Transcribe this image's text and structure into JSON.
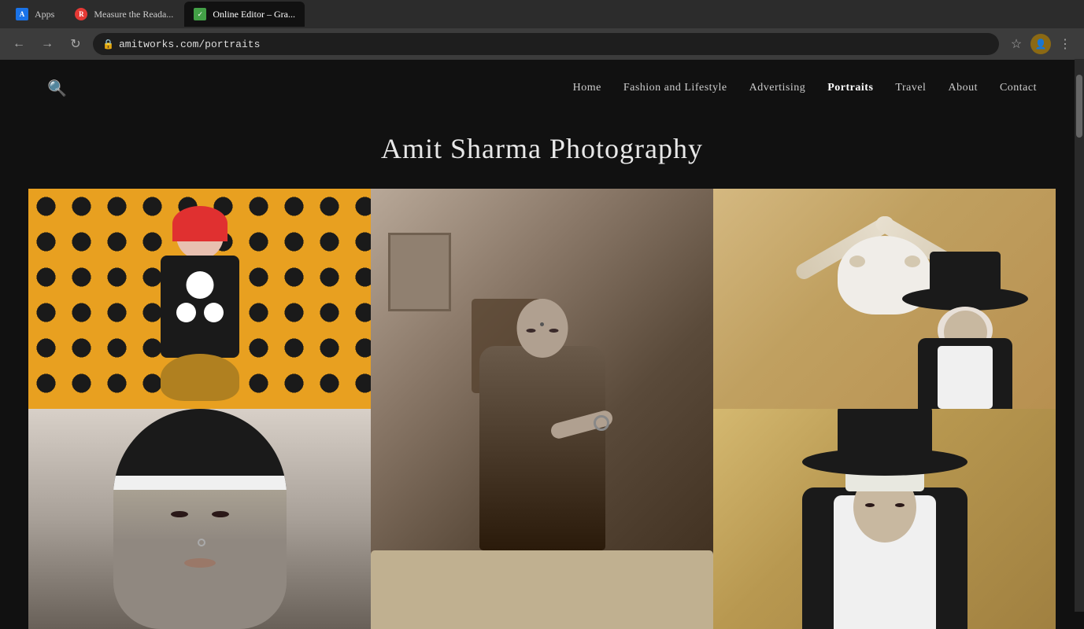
{
  "browser": {
    "url": "amitworks.com/portraits",
    "protocol_icon": "🔒",
    "back_btn": "←",
    "forward_btn": "→",
    "refresh_btn": "↻"
  },
  "tabs": [
    {
      "id": "apps",
      "label": "Apps",
      "favicon_type": "apps",
      "active": false
    },
    {
      "id": "measure",
      "label": "Measure the Reada...",
      "favicon_type": "red",
      "active": false
    },
    {
      "id": "editor",
      "label": "Online Editor – Gra...",
      "favicon_type": "green",
      "active": true
    }
  ],
  "site": {
    "nav": {
      "search_icon": "🔍",
      "links": [
        {
          "id": "home",
          "label": "Home",
          "active": false
        },
        {
          "id": "fashion",
          "label": "Fashion and Lifestyle",
          "active": false
        },
        {
          "id": "advertising",
          "label": "Advertising",
          "active": false
        },
        {
          "id": "portraits",
          "label": "Portraits",
          "active": true
        },
        {
          "id": "travel",
          "label": "Travel",
          "active": false
        },
        {
          "id": "about",
          "label": "About",
          "active": false
        },
        {
          "id": "contact",
          "label": "Contact",
          "active": false
        }
      ]
    },
    "title": "Amit Sharma Photography",
    "gallery": {
      "items": [
        {
          "id": "img1",
          "row": 0,
          "col": 0,
          "alt": "Woman in yellow polka dot setting with red wig"
        },
        {
          "id": "img2",
          "row": 0,
          "col": 1,
          "alt": "Black and white portrait of woman in saree"
        },
        {
          "id": "img3",
          "row": 0,
          "col": 2,
          "alt": "Bull skull on tan wall with woman in black hat"
        },
        {
          "id": "img4",
          "row": 1,
          "col": 0,
          "alt": "Black and white close-up face with head covering"
        },
        {
          "id": "img5",
          "row": 1,
          "col": 1,
          "alt": "Seated woman in saree black and white"
        },
        {
          "id": "img6",
          "row": 1,
          "col": 2,
          "alt": "Woman in wide brim hat against textured wall"
        }
      ]
    }
  }
}
